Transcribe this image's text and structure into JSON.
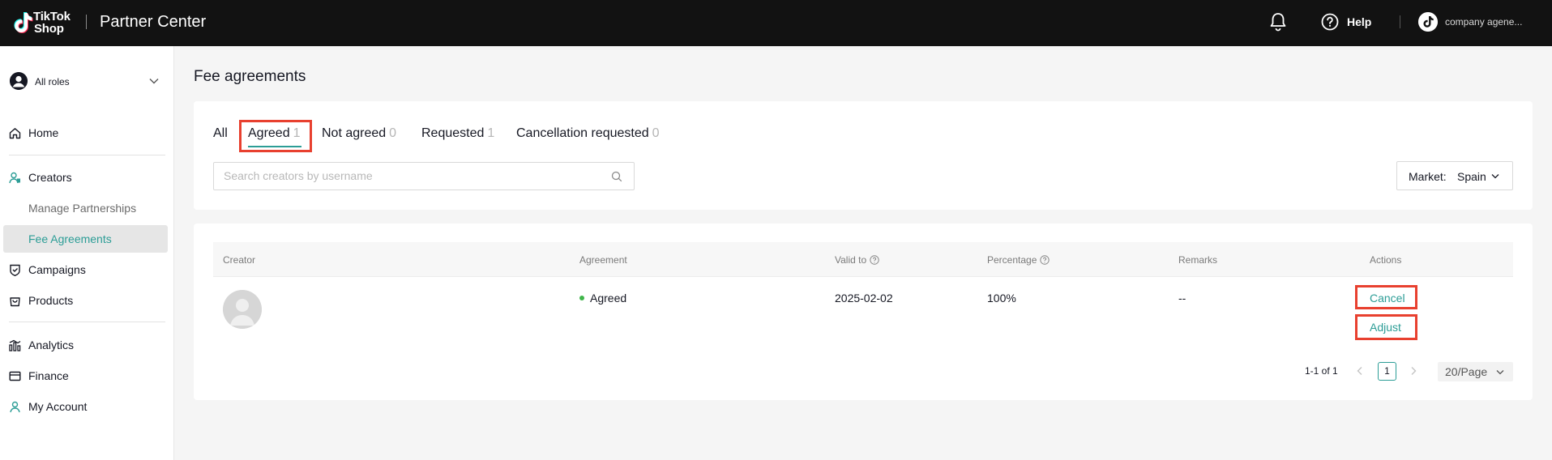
{
  "header": {
    "logo_line1": "TikTok",
    "logo_line2": "Shop",
    "app_title": "Partner Center",
    "help_label": "Help",
    "account_name": "company agene..."
  },
  "sidebar": {
    "role_label": "All roles",
    "items": [
      {
        "label": "Home",
        "icon": "home-icon"
      },
      {
        "label": "Creators",
        "icon": "creators-icon"
      },
      {
        "label": "Manage Partnerships"
      },
      {
        "label": "Fee Agreements",
        "active": true
      },
      {
        "label": "Campaigns",
        "icon": "campaigns-icon"
      },
      {
        "label": "Products",
        "icon": "products-icon"
      },
      {
        "label": "Analytics",
        "icon": "analytics-icon"
      },
      {
        "label": "Finance",
        "icon": "finance-icon"
      },
      {
        "label": "My Account",
        "icon": "account-icon"
      }
    ]
  },
  "main": {
    "title": "Fee agreements",
    "tabs": [
      {
        "label": "All",
        "count": ""
      },
      {
        "label": "Agreed",
        "count": "1",
        "selected": true
      },
      {
        "label": "Not agreed",
        "count": "0"
      },
      {
        "label": "Requested",
        "count": "1"
      },
      {
        "label": "Cancellation requested",
        "count": "0"
      }
    ],
    "search_placeholder": "Search creators by username",
    "market_label": "Market:",
    "market_value": "Spain"
  },
  "table": {
    "columns": [
      "Creator",
      "Agreement",
      "Valid to",
      "Percentage",
      "Remarks",
      "Actions"
    ],
    "rows": [
      {
        "creator": "",
        "agreement": "Agreed",
        "valid_to": "2025-02-02",
        "percentage": "100%",
        "remarks": "--",
        "actions": [
          "Cancel",
          "Adjust"
        ]
      }
    ]
  },
  "pagination": {
    "summary": "1-1 of 1",
    "current_page": "1",
    "page_size": "20/Page"
  },
  "colors": {
    "accent": "#2c9d96",
    "highlight": "#e8402f",
    "status_green": "#3fb54a",
    "topbar": "#121212"
  }
}
